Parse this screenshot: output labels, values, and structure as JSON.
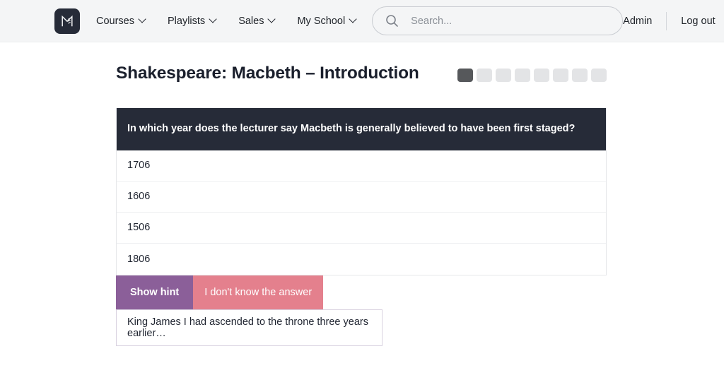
{
  "nav": {
    "logo_icon": "letter-m-logo",
    "items": [
      {
        "label": "Courses",
        "has_dropdown": true
      },
      {
        "label": "Playlists",
        "has_dropdown": true
      },
      {
        "label": "Sales",
        "has_dropdown": true
      },
      {
        "label": "My School",
        "has_dropdown": true
      }
    ],
    "search": {
      "icon": "search-icon",
      "placeholder": "Search...",
      "value": ""
    },
    "admin_label": "Admin",
    "logout_label": "Log out"
  },
  "page": {
    "title": "Shakespeare: Macbeth – Introduction",
    "progress": {
      "total": 8,
      "completed": 1,
      "done_color": "#56585b",
      "pending_color": "#e3e4e6"
    }
  },
  "quiz": {
    "question": "In which year does the lecturer say Macbeth is generally believed to have been first staged?",
    "question_bg": "#262b38",
    "answers": [
      {
        "label": "1706"
      },
      {
        "label": "1606"
      },
      {
        "label": "1506"
      },
      {
        "label": "1806"
      }
    ],
    "buttons": {
      "hint_label": "Show hint",
      "hint_color": "#8b5f99",
      "dont_know_label": "I don't know the answer",
      "dont_know_color": "#e4808d"
    },
    "hint_text": "King James I had ascended to the throne three years earlier…"
  }
}
